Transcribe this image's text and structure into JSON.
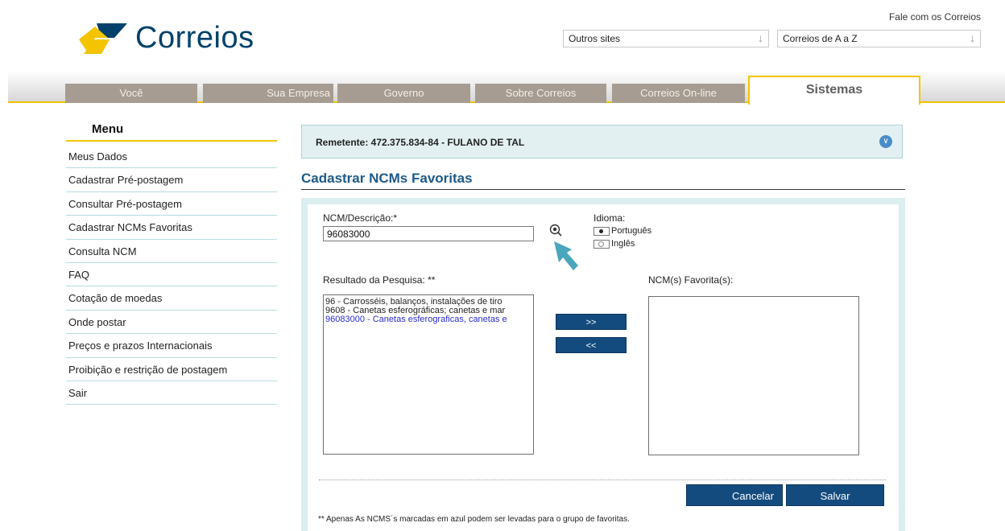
{
  "header": {
    "contact_link": "Fale com os Correios",
    "logo_text": "Correios",
    "select_other_sites": "Outros sites",
    "select_a_to_z": "Correios de A a Z"
  },
  "nav": {
    "tabs": [
      "Você",
      "Sua Empresa",
      "Governo",
      "Sobre Correios",
      "Correios On-line"
    ],
    "active_tab": "Sistemas"
  },
  "sidebar": {
    "title": "Menu",
    "items": [
      "Meus Dados",
      "Cadastrar Pré-postagem",
      "Consultar Pré-postagem",
      "Cadastrar NCMs Favoritas",
      "Consulta NCM",
      "FAQ",
      "Cotação de moedas",
      "Onde postar",
      "Preços e prazos Internacionais",
      "Proibição e restrição de postagem",
      "Sair"
    ]
  },
  "sender": {
    "text": "Remetente: 472.375.834-84 - FULANO DE TAL"
  },
  "page": {
    "title": "Cadastrar NCMs Favoritas"
  },
  "form": {
    "ncm_label": "NCM/Descrição:*",
    "ncm_value": "96083000",
    "language_label": "Idioma:",
    "language_options": [
      "Português",
      "Inglês"
    ],
    "language_selected": "Português",
    "results_label": "Resultado da Pesquisa: **",
    "results": [
      "96 - Carrosséis, balanços, instalações de tiro",
      "9608 - Canetas esferográficas; canetas e mar",
      "96083000 - Canetas esferograficas, canetas e"
    ],
    "favorites_label": "NCM(s) Favorita(s):",
    "add_button": ">>",
    "remove_button": "<<",
    "cancel_button": "Cancelar",
    "save_button": "Salvar",
    "footnote": "** Apenas As NCMS´s marcadas em azul podem ser levadas para o grupo de favoritas."
  },
  "colors": {
    "brand_blue": "#00416b",
    "brand_yellow": "#f4c400",
    "button_blue": "#144b7e",
    "tab_gray": "#a69c91",
    "highlight_result": "#2b2bd8"
  }
}
